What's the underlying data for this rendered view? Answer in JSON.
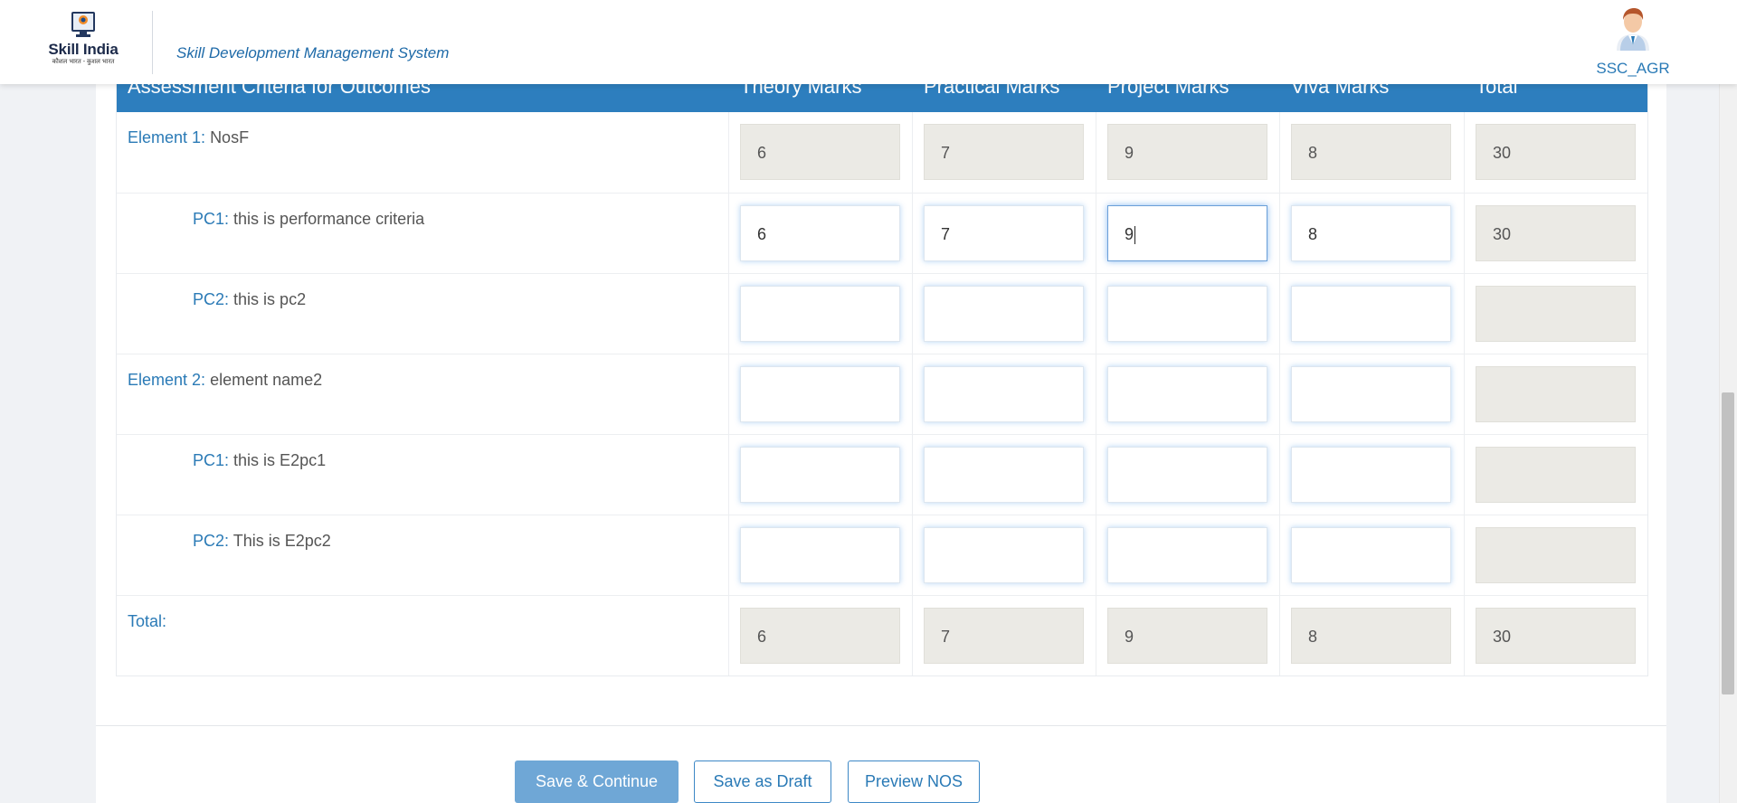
{
  "header": {
    "logo_title": "Skill India",
    "logo_subtitle": "कौशल भारत - कुशल भारत",
    "app_title": "Skill Development Management System",
    "user_name": "SSC_AGR"
  },
  "table": {
    "columns": [
      "Assessment Criteria for Outcomes",
      "Theory Marks",
      "Practical Marks",
      "Project Marks",
      "Viva Marks",
      "Total"
    ],
    "rows": [
      {
        "key": "Element 1:",
        "text": "NosF",
        "theory": "6",
        "practical": "7",
        "project": "9",
        "viva": "8",
        "total": "30",
        "editable": false
      },
      {
        "key": "PC1:",
        "text": "this is performance criteria",
        "theory": "6",
        "practical": "7",
        "project": "9",
        "viva": "8",
        "total": "30",
        "editable": true
      },
      {
        "key": "PC2:",
        "text": "this is pc2",
        "theory": "",
        "practical": "",
        "project": "",
        "viva": "",
        "total": "",
        "editable": true
      },
      {
        "key": "Element 2:",
        "text": "element name2",
        "theory": "",
        "practical": "",
        "project": "",
        "viva": "",
        "total": "",
        "editable": true
      },
      {
        "key": "PC1:",
        "text": "this is E2pc1",
        "theory": "",
        "practical": "",
        "project": "",
        "viva": "",
        "total": "",
        "editable": true
      },
      {
        "key": "PC2:",
        "text": "This is E2pc2",
        "theory": "",
        "practical": "",
        "project": "",
        "viva": "",
        "total": "",
        "editable": true
      },
      {
        "key": "Total:",
        "text": "",
        "theory": "6",
        "practical": "7",
        "project": "9",
        "viva": "8",
        "total": "30",
        "editable": false
      }
    ]
  },
  "actions": {
    "save_continue": "Save & Continue",
    "save_draft": "Save as Draft",
    "preview": "Preview NOS"
  }
}
